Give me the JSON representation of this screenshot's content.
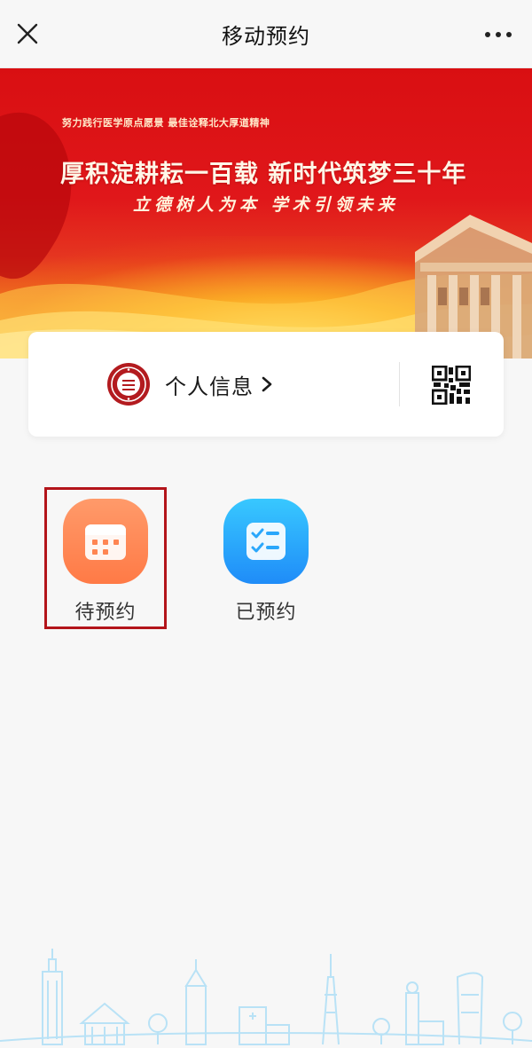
{
  "header": {
    "title": "移动预约"
  },
  "banner": {
    "small_text": "努力践行医学原点愿景  最佳诠释北大厚道精神",
    "main_text": "厚积淀耕耘一百载  新时代筑梦三十年",
    "sub_text": "立德树人为本  学术引领未来"
  },
  "info_card": {
    "label": "个人信息"
  },
  "functions": [
    {
      "label": "待预约",
      "icon": "calendar-icon",
      "color": "#ff8552"
    },
    {
      "label": "已预约",
      "icon": "checklist-icon",
      "color": "#2aa7fb"
    }
  ],
  "colors": {
    "highlight_border": "#b3141a",
    "banner_red": "#d90f12",
    "skyline": "#b9e2f6"
  }
}
